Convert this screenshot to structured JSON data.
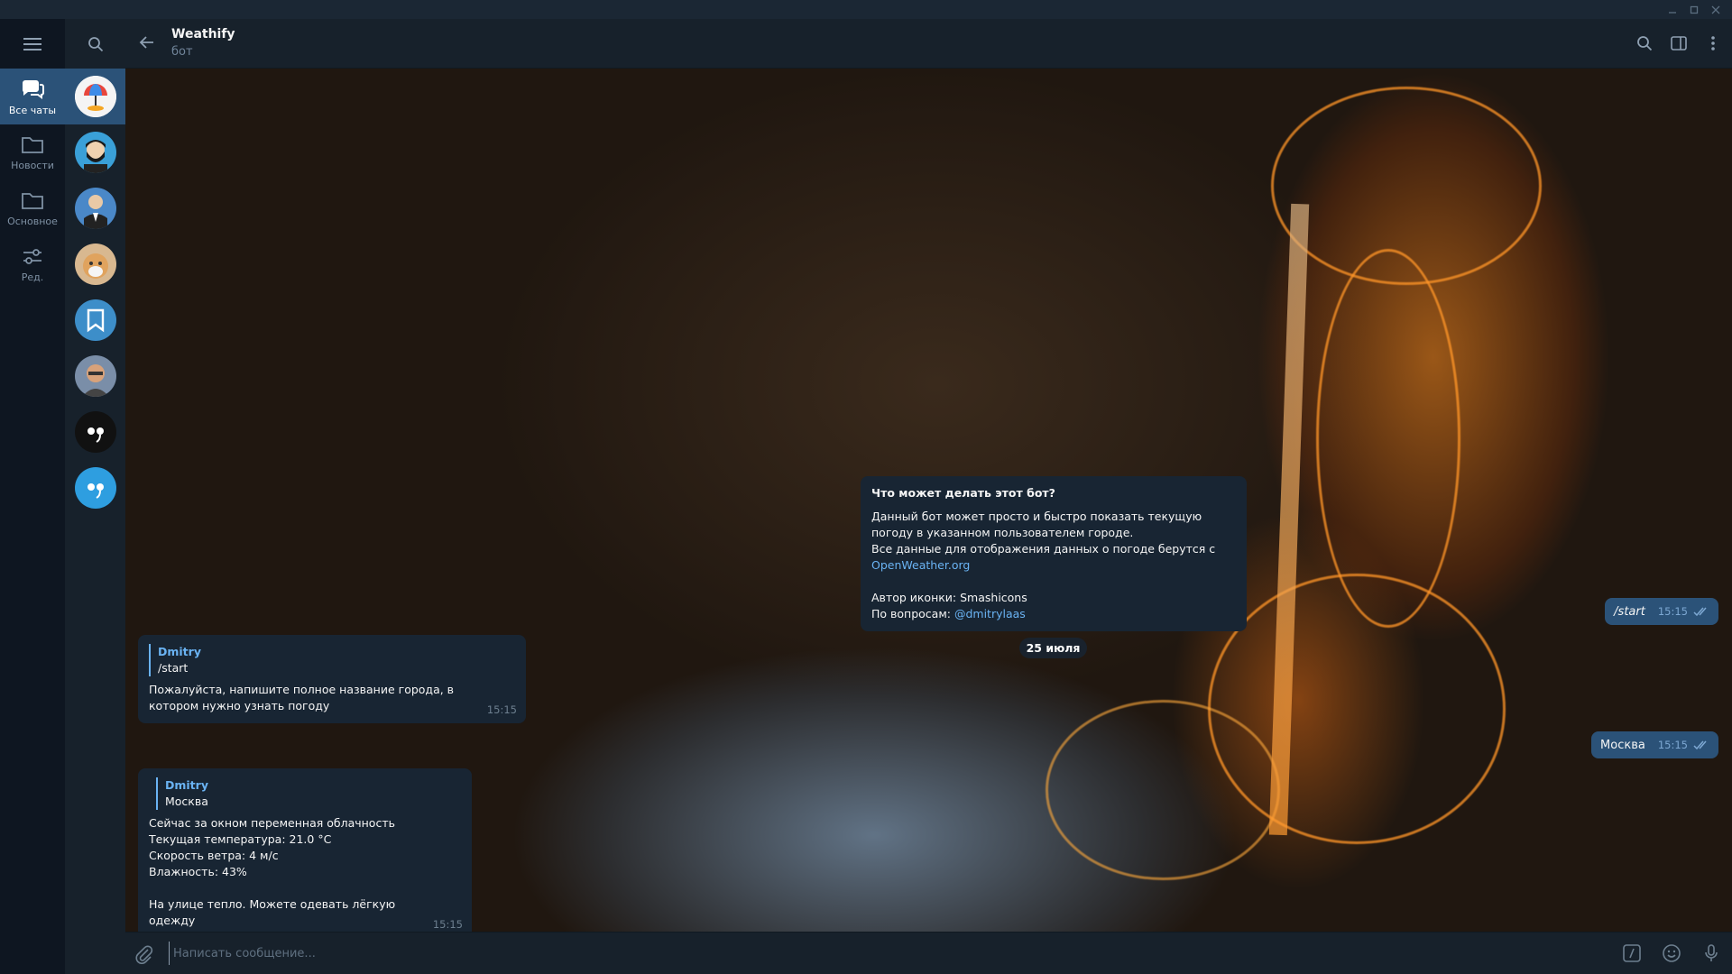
{
  "colors": {
    "accent": "#6ab3f3",
    "active_folder": "#2b5278",
    "bubble_in": "#182533",
    "bubble_out": "#2b5278"
  },
  "folders": [
    {
      "label": "Все чаты",
      "icon": "chats-icon",
      "active": true
    },
    {
      "label": "Новости",
      "icon": "folder-icon",
      "active": false
    },
    {
      "label": "Основное",
      "icon": "folder-icon",
      "active": false
    },
    {
      "label": "Ред.",
      "icon": "edit-filters-icon",
      "active": false
    }
  ],
  "chat_avatars": [
    "weathify-avatar",
    "bearded-man-avatar",
    "man-in-suit-avatar",
    "cat-avatar",
    "saved-messages-avatar",
    "man-avatar",
    "dark-face-avatar",
    "blue-face-avatar"
  ],
  "header": {
    "title": "Weathify",
    "subtitle": "бот"
  },
  "bot_info": {
    "title": "Что может делать этот бот?",
    "line1": "Данный бот может просто и быстро показать текущую погоду в указанном пользователем городе.",
    "line2": "Все данные для отображения данных о погоде берутся с",
    "link1": "OpenWeather.org",
    "line3": "Автор иконки: Smashicons",
    "line4": "По вопросам:",
    "link2": "@dmitrylaas"
  },
  "date_pill": "25 июля",
  "messages_out": [
    {
      "text": "/start",
      "time": "15:15"
    },
    {
      "text": "Москва",
      "time": "15:15"
    }
  ],
  "messages_in": [
    {
      "reply_name": "Dmitry",
      "reply_text": "/start",
      "lines": [
        "Пожалуйста, напишите полное название города, в котором нужно узнать погоду"
      ],
      "time": "15:15"
    },
    {
      "reply_name": "Dmitry",
      "reply_text": "Москва",
      "lines": [
        "Сейчас за окном переменная облачность",
        "Текущая температура:  21.0 °C",
        "Скорость ветра:  4 м/с",
        "Влажность:  43%"
      ],
      "footer": "На улице тепло. Можете одевать лёгкую одежду",
      "time": "15:15"
    }
  ],
  "composer": {
    "placeholder": "Написать сообщение..."
  }
}
